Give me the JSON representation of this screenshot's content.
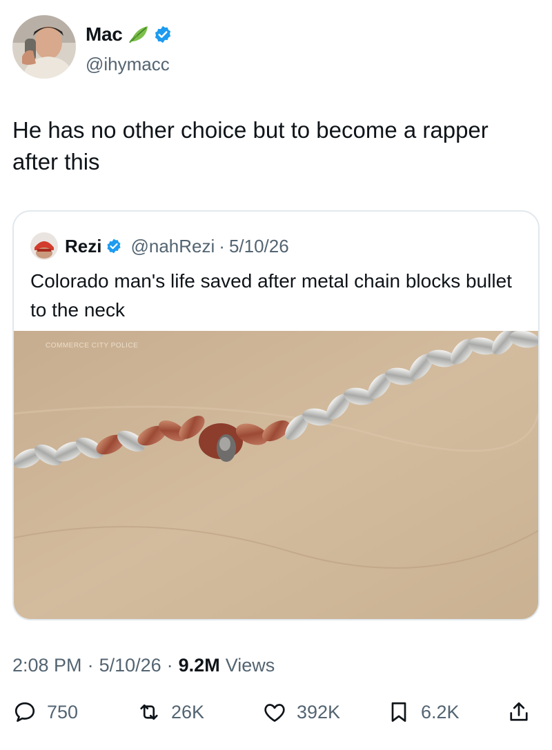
{
  "author": {
    "display_name": "Mac",
    "handle": "@ihymacc",
    "avatar": "profile-photo",
    "badge_icon": "leaf-icon",
    "verified_icon": "verified-badge-icon"
  },
  "tweet": {
    "text": "He has no other choice but to become a rapper after this"
  },
  "quote": {
    "display_name": "Rezi",
    "handle": "@nahRezi",
    "separator": "·",
    "date": "5/10/26",
    "text": "Colorado man's life saved after metal chain blocks bullet to the neck",
    "media": {
      "description_icon": "chain-photo",
      "watermark": "COMMERCE CITY POLICE"
    }
  },
  "meta": {
    "time": "2:08 PM",
    "date": "5/10/26",
    "views_count": "9.2M",
    "views_label": "Views",
    "separator": "·"
  },
  "actions": {
    "reply_count": "750",
    "repost_count": "26K",
    "like_count": "392K",
    "bookmark_count": "6.2K"
  },
  "colors": {
    "text_primary": "#0f1419",
    "text_secondary": "#536471",
    "verified_blue": "#1d9bf0",
    "border": "#e1e8ed"
  }
}
